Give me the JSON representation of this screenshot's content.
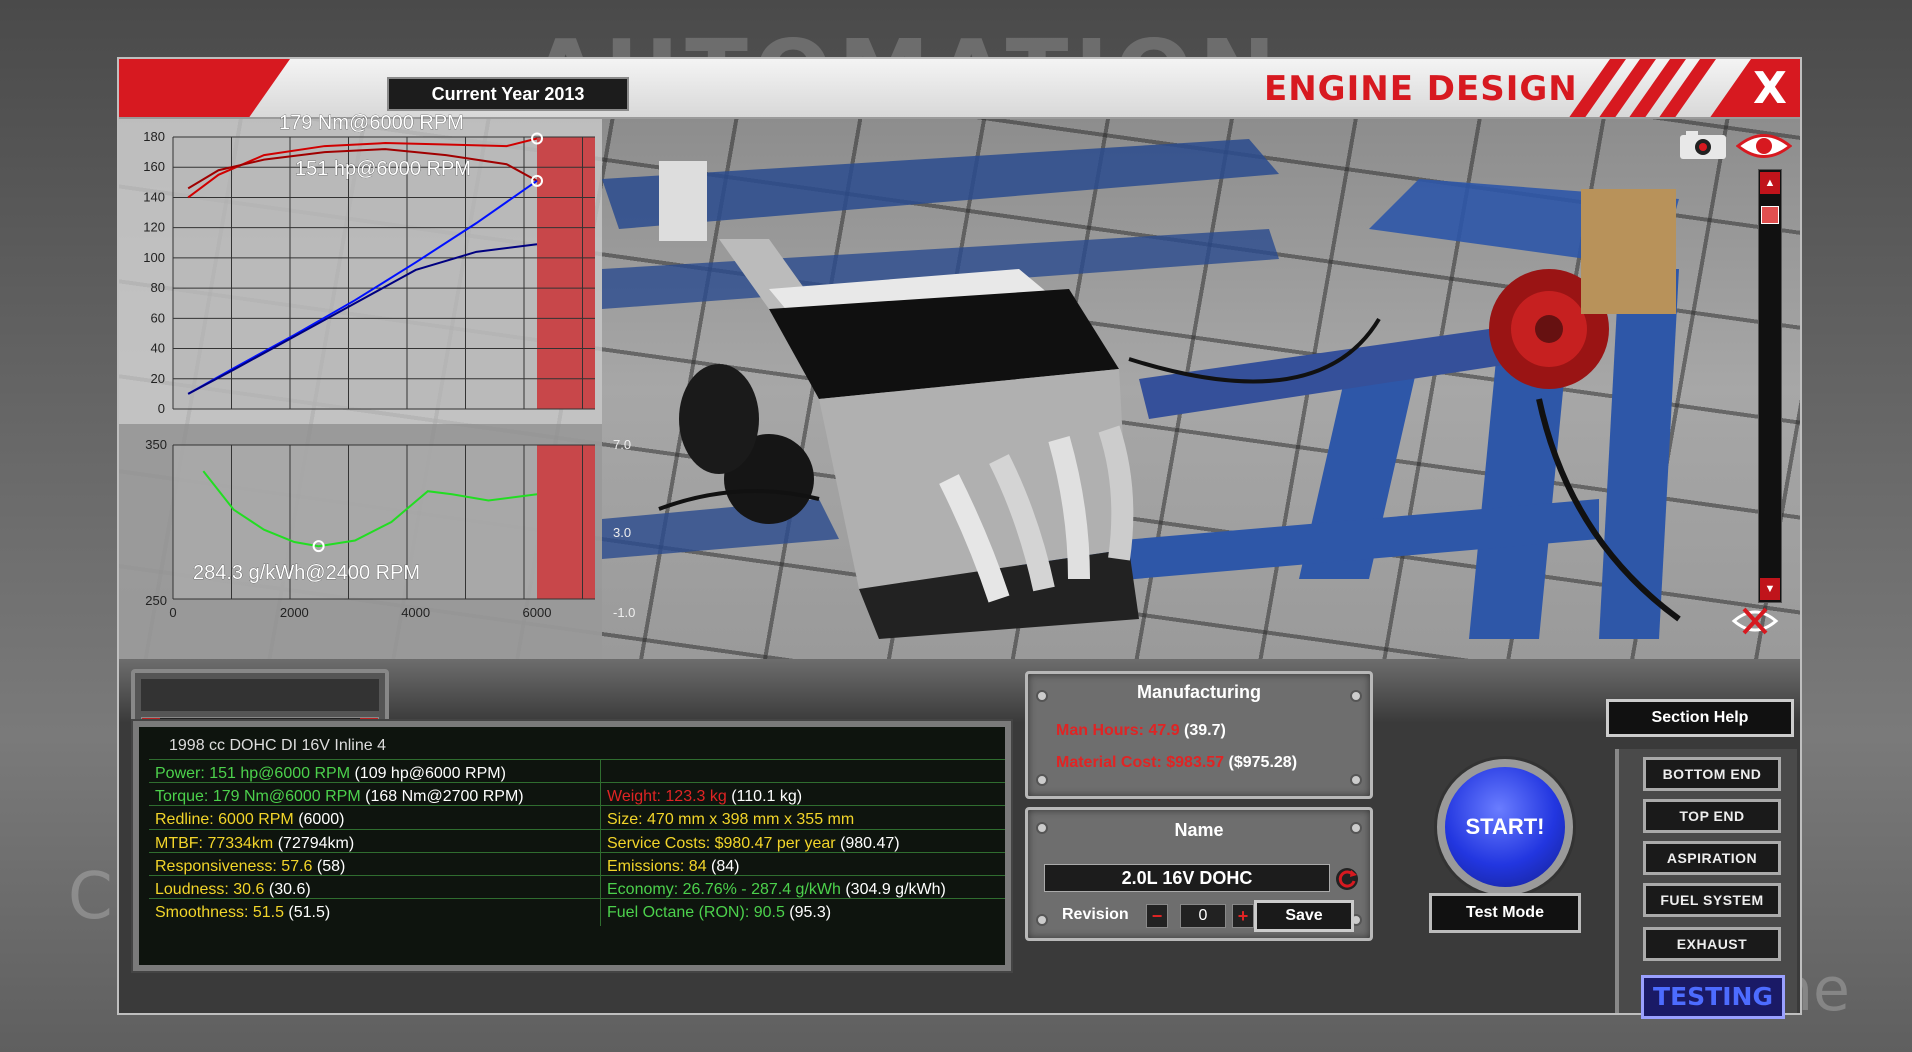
{
  "background": {
    "logo": "AUTOMATION",
    "left_text": "C\nO",
    "right_text": "ne"
  },
  "header": {
    "year_label": "Current Year 2013",
    "title": "ENGINE DESIGN",
    "close_label": "X"
  },
  "graphs": {
    "torque_power": {
      "ylim": [
        0,
        180
      ],
      "yticks": [
        "180",
        "160",
        "140",
        "120",
        "100",
        "80",
        "60",
        "40",
        "20",
        "0"
      ],
      "xlim": [
        0,
        7000
      ],
      "annotation_torque": "179 Nm@6000 RPM",
      "annotation_power": "151 hp@6000 RPM",
      "series": [
        {
          "x": [
            250,
            750,
            1500,
            2500,
            3500,
            4500,
            5500,
            6000
          ],
          "y": [
            140,
            155,
            168,
            174,
            176,
            175,
            174,
            179
          ],
          "color": "#d00000"
        },
        {
          "x": [
            250,
            750,
            1500,
            2500,
            3500,
            4500,
            5500,
            6000
          ],
          "y": [
            146,
            158,
            165,
            170,
            172,
            168,
            162,
            151
          ],
          "color": "#a00000"
        },
        {
          "x": [
            250,
            1000,
            2000,
            3000,
            4000,
            5000,
            6000
          ],
          "y": [
            10,
            27,
            49,
            72,
            97,
            123,
            151
          ],
          "color": "#0010ff"
        },
        {
          "x": [
            250,
            1000,
            2000,
            3000,
            4000,
            5000,
            6000
          ],
          "y": [
            10,
            26,
            48,
            70,
            92,
            104,
            109
          ],
          "color": "#000080"
        }
      ]
    },
    "bsfc": {
      "ylim": [
        250,
        350
      ],
      "yticks": [
        "350",
        "250"
      ],
      "xticks": [
        "0",
        "2000",
        "4000",
        "6000"
      ],
      "right_ticks": [
        "7.0",
        "3.0",
        "-1.0"
      ],
      "annotation": "284.3 g/kWh@2400 RPM",
      "series": {
        "x": [
          500,
          1000,
          1500,
          2000,
          2400,
          3000,
          3600,
          4200,
          4600,
          5200,
          6000
        ],
        "y": [
          333,
          308,
          295,
          287,
          284.3,
          288,
          300,
          320,
          318,
          314,
          318
        ],
        "color": "#22dd22"
      }
    }
  },
  "section_help_label": "Section Help",
  "stats": {
    "engine_title": "1998 cc DOHC DI 16V Inline 4",
    "rows_left": [
      {
        "label": "Power: 151 hp@6000 RPM",
        "extra": " (109 hp@6000 RPM)",
        "color": "g"
      },
      {
        "label": "Torque: 179 Nm@6000 RPM",
        "extra": " (168 Nm@2700 RPM)",
        "color": "g"
      },
      {
        "label": "Redline: 6000 RPM",
        "extra": " (6000)",
        "color": "y"
      },
      {
        "label": "MTBF: 77334km",
        "extra": " (72794km)",
        "color": "y"
      },
      {
        "label": "Responsiveness: 57.6",
        "extra": " (58)",
        "color": "y"
      },
      {
        "label": "Loudness: 30.6",
        "extra": " (30.6)",
        "color": "y"
      },
      {
        "label": "Smoothness: 51.5",
        "extra": " (51.5)",
        "color": "y"
      }
    ],
    "rows_right": [
      {
        "label": "",
        "extra": "",
        "color": "v"
      },
      {
        "label": "Weight: 123.3 kg",
        "extra": " (110.1 kg)",
        "color": "r"
      },
      {
        "label": "Size: 470 mm x 398 mm x 355 mm",
        "extra": "",
        "color": "y"
      },
      {
        "label": "Service Costs: $980.47 per year",
        "extra": " (980.47)",
        "color": "y"
      },
      {
        "label": "Emissions: 84",
        "extra": " (84)",
        "color": "y"
      },
      {
        "label": "Economy: 26.76% - 287.4 g/kWh",
        "extra": " (304.9 g/kWh)",
        "color": "g"
      },
      {
        "label": "Fuel Octane (RON): 90.5",
        "extra": " (95.3)",
        "color": "g"
      }
    ]
  },
  "manufacturing": {
    "title": "Manufacturing",
    "man_hours": "Man Hours: 47.9",
    "man_hours_prev": " (39.7)",
    "material_cost": "Material Cost: $983.57",
    "material_cost_prev": " ($975.28)"
  },
  "name_panel": {
    "title": "Name",
    "name_value": "2.0L 16V DOHC",
    "revision_label": "Revision",
    "revision_value": "0",
    "minus_label": "−",
    "plus_label": "+",
    "save_label": "Save"
  },
  "start_label": "START!",
  "test_mode_label": "Test Mode",
  "nav": {
    "items": [
      "BOTTOM END",
      "TOP END",
      "ASPIRATION",
      "FUEL SYSTEM",
      "EXHAUST"
    ],
    "active": "TESTING"
  },
  "colors": {
    "accent_red": "#d71920",
    "start_blue": "#2236e0",
    "green_text": "#4cd14c",
    "yellow_text": "#f2d52a"
  }
}
